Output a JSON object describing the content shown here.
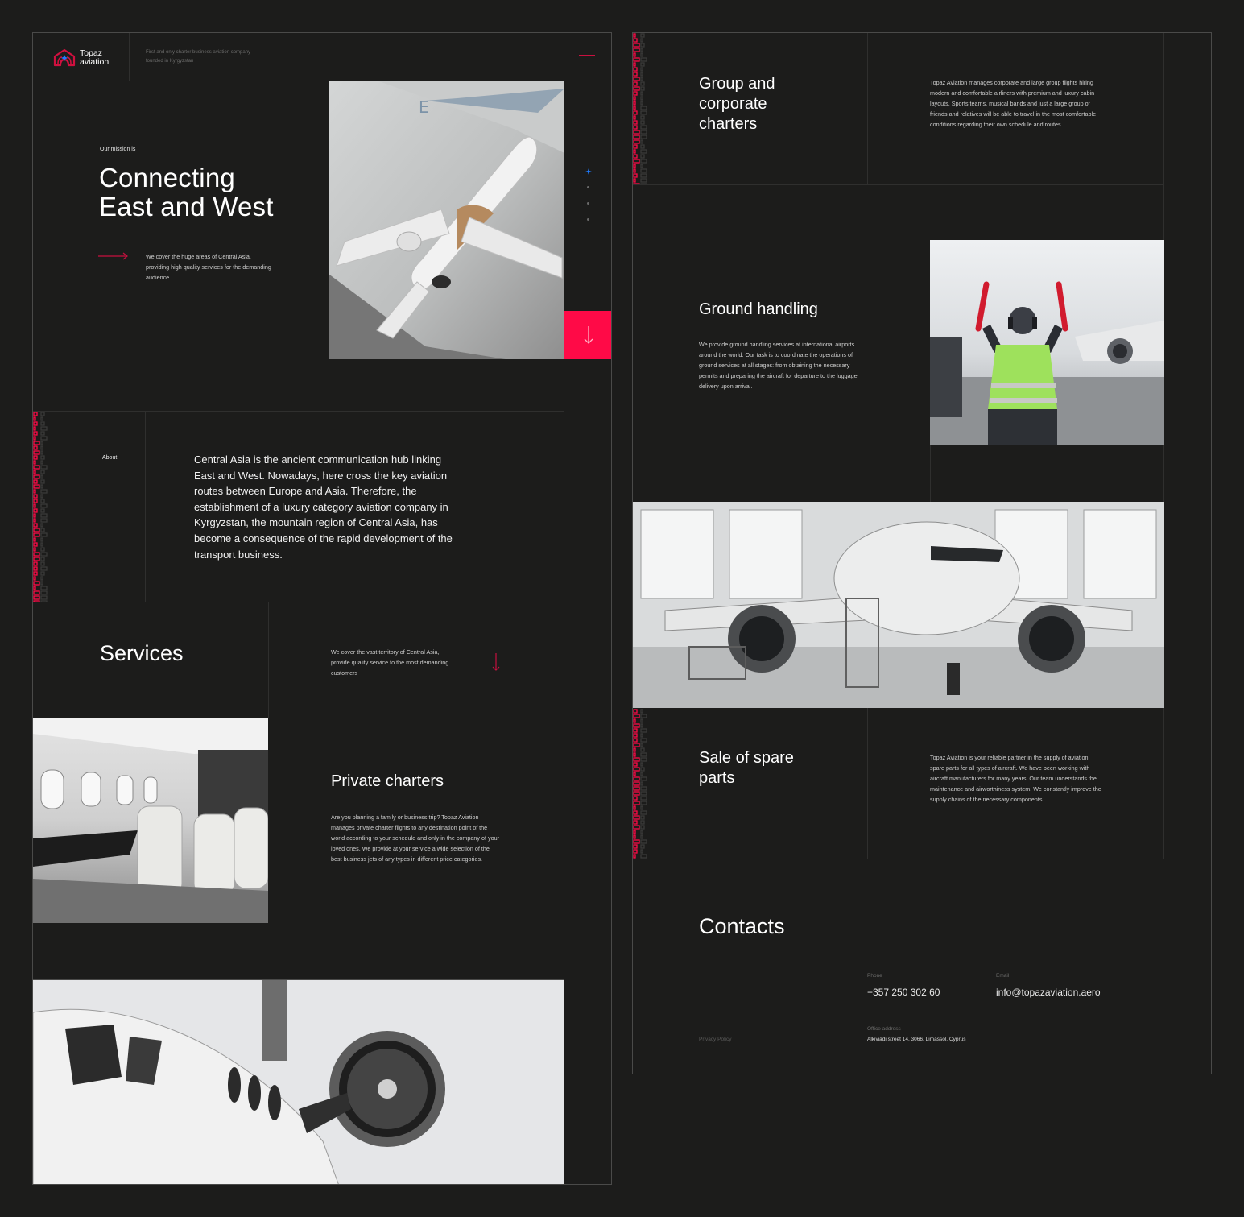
{
  "header": {
    "logo_line1": "Topaz",
    "logo_line2": "aviation",
    "tagline": "First and only charter business aviation company founded in Kyrgyzstan",
    "menu_icon": "hamburger-menu-icon"
  },
  "hero": {
    "eyebrow": "Our mission is",
    "title_line1": "Connecting",
    "title_line2": "East and West",
    "description": "We cover the huge areas of Central Asia, providing high quality services for the demanding audience.",
    "arrow_icon": "arrow-right-icon",
    "scroll_button_icon": "arrow-down-icon",
    "slider_dots": {
      "count": 4,
      "active_index": 0
    },
    "image_alt": "Business jet parked on apron, aerial view"
  },
  "about": {
    "label": "About",
    "text": "Central Asia is the ancient communication hub linking East and West. Nowadays, here cross the key aviation routes between Europe and Asia. Therefore, the establishment of a luxury category aviation company in Kyrgyzstan, the mountain region of Central Asia, has become a consequence of the rapid development of the transport business."
  },
  "services": {
    "title": "Services",
    "intro": "We cover the vast territory of Central Asia, provide quality service to the most demanding customers",
    "items": [
      {
        "title": "Private charters",
        "text": "Are you planning a family or business trip? Topaz Aviation manages private charter flights to any destination point of the world according to your schedule and only in the company of your loved ones. We provide at your service a wide selection of the best business jets of any types in different price categories.",
        "image_alt": "Business jet cabin interior with leather seats"
      },
      {
        "title": "Group and corporate charters",
        "text": "Topaz Aviation manages corporate and large group flights hiring modern and comfortable airliners with premium and luxury cabin layouts. Sports teams, musical bands and just a large group of friends and relatives will be able to travel in the most comfortable conditions regarding their own schedule and routes."
      },
      {
        "title": "Ground handling",
        "text": "We provide ground handling services at international airports around the world. Our task is to coordinate the operations of ground services at all stages: from obtaining the necessary permits and preparing the aircraft for departure to the luggage delivery upon arrival.",
        "image_alt": "Ground marshaller with signal wands guiding aircraft"
      },
      {
        "title": "Sale of spare parts",
        "text": "Topaz Aviation is your reliable partner in the supply of aviation spare parts for all types of aircraft. We have been working with aircraft manufacturers for many years. Our team understands the maintenance and airworthiness system. We constantly improve the supply chains of the necessary components.",
        "image_alt": "Airliner under maintenance in hangar"
      }
    ],
    "bottom_image_alt": "Close-up of business jet fuselage and engine"
  },
  "contacts": {
    "title": "Contacts",
    "phone_label": "Phone",
    "phone": "+357 250 302 60",
    "email_label": "Email",
    "email": "info@topazaviation.aero",
    "address_label": "Office address",
    "address": "Alkiviadi street 14, 3066, Limassol, Cyprus",
    "privacy_link": "Privacy Policy"
  },
  "colors": {
    "background": "#1c1c1b",
    "accent_red": "#ff0a47",
    "accent_dark_red": "#c8103f",
    "accent_blue": "#1e7bff",
    "grid_line": "#2f2f2e"
  }
}
